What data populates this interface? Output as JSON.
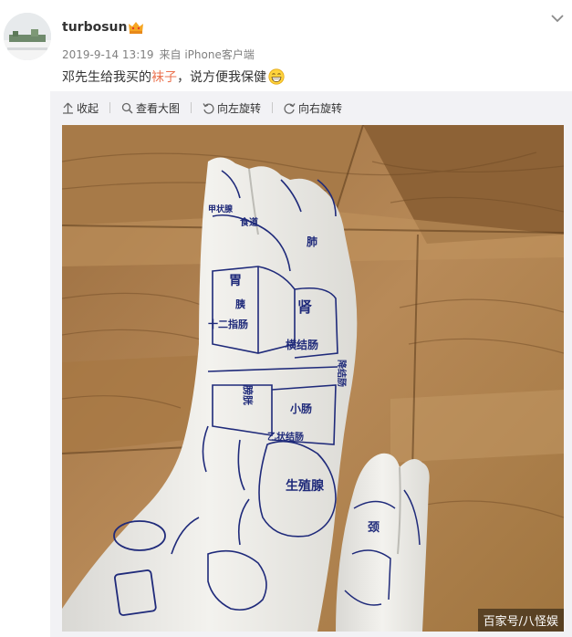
{
  "post": {
    "username": "turbosun",
    "timestamp": "2019-9-14 13:19",
    "source": "来自 iPhone客户端",
    "text_before": "邓先生给我买的",
    "link_text": "袜子",
    "text_after": "，说方便我保健"
  },
  "toolbar": {
    "collapse": "收起",
    "view_large": "查看大图",
    "rotate_left": "向左旋转",
    "rotate_right": "向右旋转"
  },
  "photo": {
    "watermark": "百家号/八怪娱",
    "sock_labels": {
      "stomach": "胃",
      "pancreas": "胰",
      "duodenum": "十二指肠",
      "kidney": "肾",
      "transverse_colon": "横结肠",
      "small_intestine": "小肠",
      "bladder": "膀胱",
      "reproductive": "生殖腺",
      "sigmoid": "乙状结肠",
      "esophagus": "食道",
      "thyroid": "甲状腺",
      "lung": "肺",
      "neck": "颈",
      "ascending_colon": "降结肠"
    }
  },
  "colors": {
    "link": "#eb7350",
    "media_bg": "#f2f2f5",
    "wood": "#b08352",
    "sock_line": "#1f2a7a"
  },
  "icons": [
    "collapse-arrow-icon",
    "search-icon",
    "rotate-left-icon",
    "rotate-right-icon",
    "vip-crown-icon",
    "grin-emoji-icon",
    "chevron-down-icon"
  ]
}
